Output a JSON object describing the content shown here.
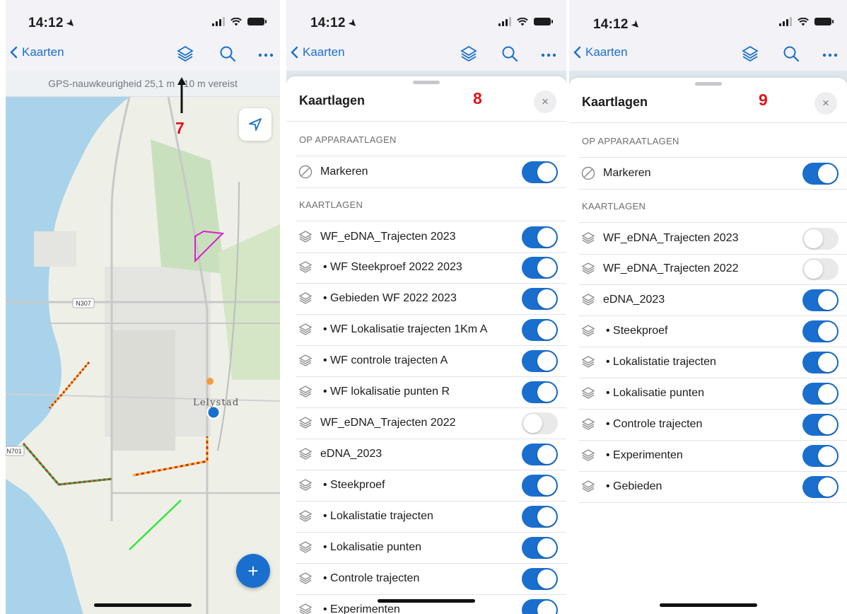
{
  "colors": {
    "accent": "#1a6fce",
    "annotation": "#e0121a",
    "toggle_off": "#e9e9ea"
  },
  "status_time": "14:12",
  "nav": {
    "back_label": "Kaarten",
    "icons": [
      "layers-icon",
      "search-icon",
      "more-icon"
    ]
  },
  "panel1": {
    "gps_text": "GPS-nauwkeurigheid 25,1 m · 10 m vereist",
    "annotation": "7",
    "map_labels": {
      "road1": "N307",
      "road2": "N701",
      "city": "Lelystad"
    },
    "fab_label": "+"
  },
  "sheet": {
    "title": "Kaartlagen",
    "close": "×",
    "section_device": "OP APPARAATLAGEN",
    "section_layers": "KAARTLAGEN",
    "marker_label": "Markeren"
  },
  "panel2": {
    "annotation": "8",
    "marker_on": true,
    "layers": [
      {
        "label": "WF_eDNA_Trajecten 2023",
        "sub": false,
        "on": true
      },
      {
        "label": "• WF Steekproef 2022 2023",
        "sub": true,
        "on": true
      },
      {
        "label": "• Gebieden WF 2022 2023",
        "sub": true,
        "on": true
      },
      {
        "label": "• WF Lokalisatie trajecten 1Km A",
        "sub": true,
        "on": true
      },
      {
        "label": "• WF controle trajecten A",
        "sub": true,
        "on": true
      },
      {
        "label": "• WF lokalisatie punten R",
        "sub": true,
        "on": true
      },
      {
        "label": "WF_eDNA_Trajecten 2022",
        "sub": false,
        "on": false
      },
      {
        "label": "eDNA_2023",
        "sub": false,
        "on": true
      },
      {
        "label": "• Steekproef",
        "sub": true,
        "on": true
      },
      {
        "label": "• Lokalistatie trajecten",
        "sub": true,
        "on": true
      },
      {
        "label": "• Lokalisatie punten",
        "sub": true,
        "on": true
      },
      {
        "label": "• Controle trajecten",
        "sub": true,
        "on": true
      },
      {
        "label": "• Experimenten",
        "sub": true,
        "on": true
      }
    ]
  },
  "panel3": {
    "annotation": "9",
    "marker_on": true,
    "layers": [
      {
        "label": "WF_eDNA_Trajecten 2023",
        "sub": false,
        "on": false
      },
      {
        "label": "WF_eDNA_Trajecten 2022",
        "sub": false,
        "on": false
      },
      {
        "label": "eDNA_2023",
        "sub": false,
        "on": true
      },
      {
        "label": "• Steekproef",
        "sub": true,
        "on": true
      },
      {
        "label": "• Lokalistatie trajecten",
        "sub": true,
        "on": true
      },
      {
        "label": "• Lokalisatie punten",
        "sub": true,
        "on": true
      },
      {
        "label": "• Controle trajecten",
        "sub": true,
        "on": true
      },
      {
        "label": "• Experimenten",
        "sub": true,
        "on": true
      },
      {
        "label": "• Gebieden",
        "sub": true,
        "on": true
      }
    ]
  }
}
